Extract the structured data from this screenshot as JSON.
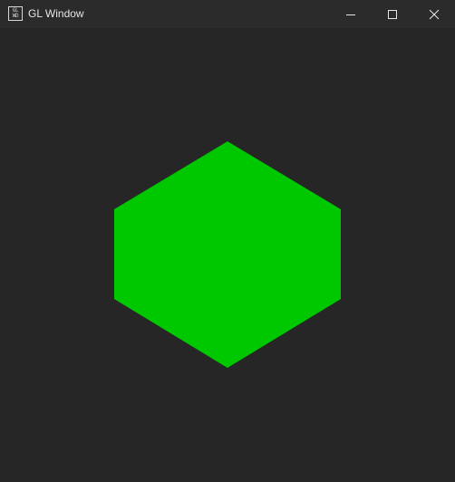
{
  "window": {
    "title": "GL Window",
    "icon_text_top": "GL",
    "icon_text_bottom": "WD",
    "controls": {
      "minimize": "minimize-icon",
      "maximize": "maximize-icon",
      "close": "close-icon"
    }
  },
  "scene": {
    "background_color": "#262626",
    "shape": "hexagon",
    "shape_color": "#00c800"
  }
}
